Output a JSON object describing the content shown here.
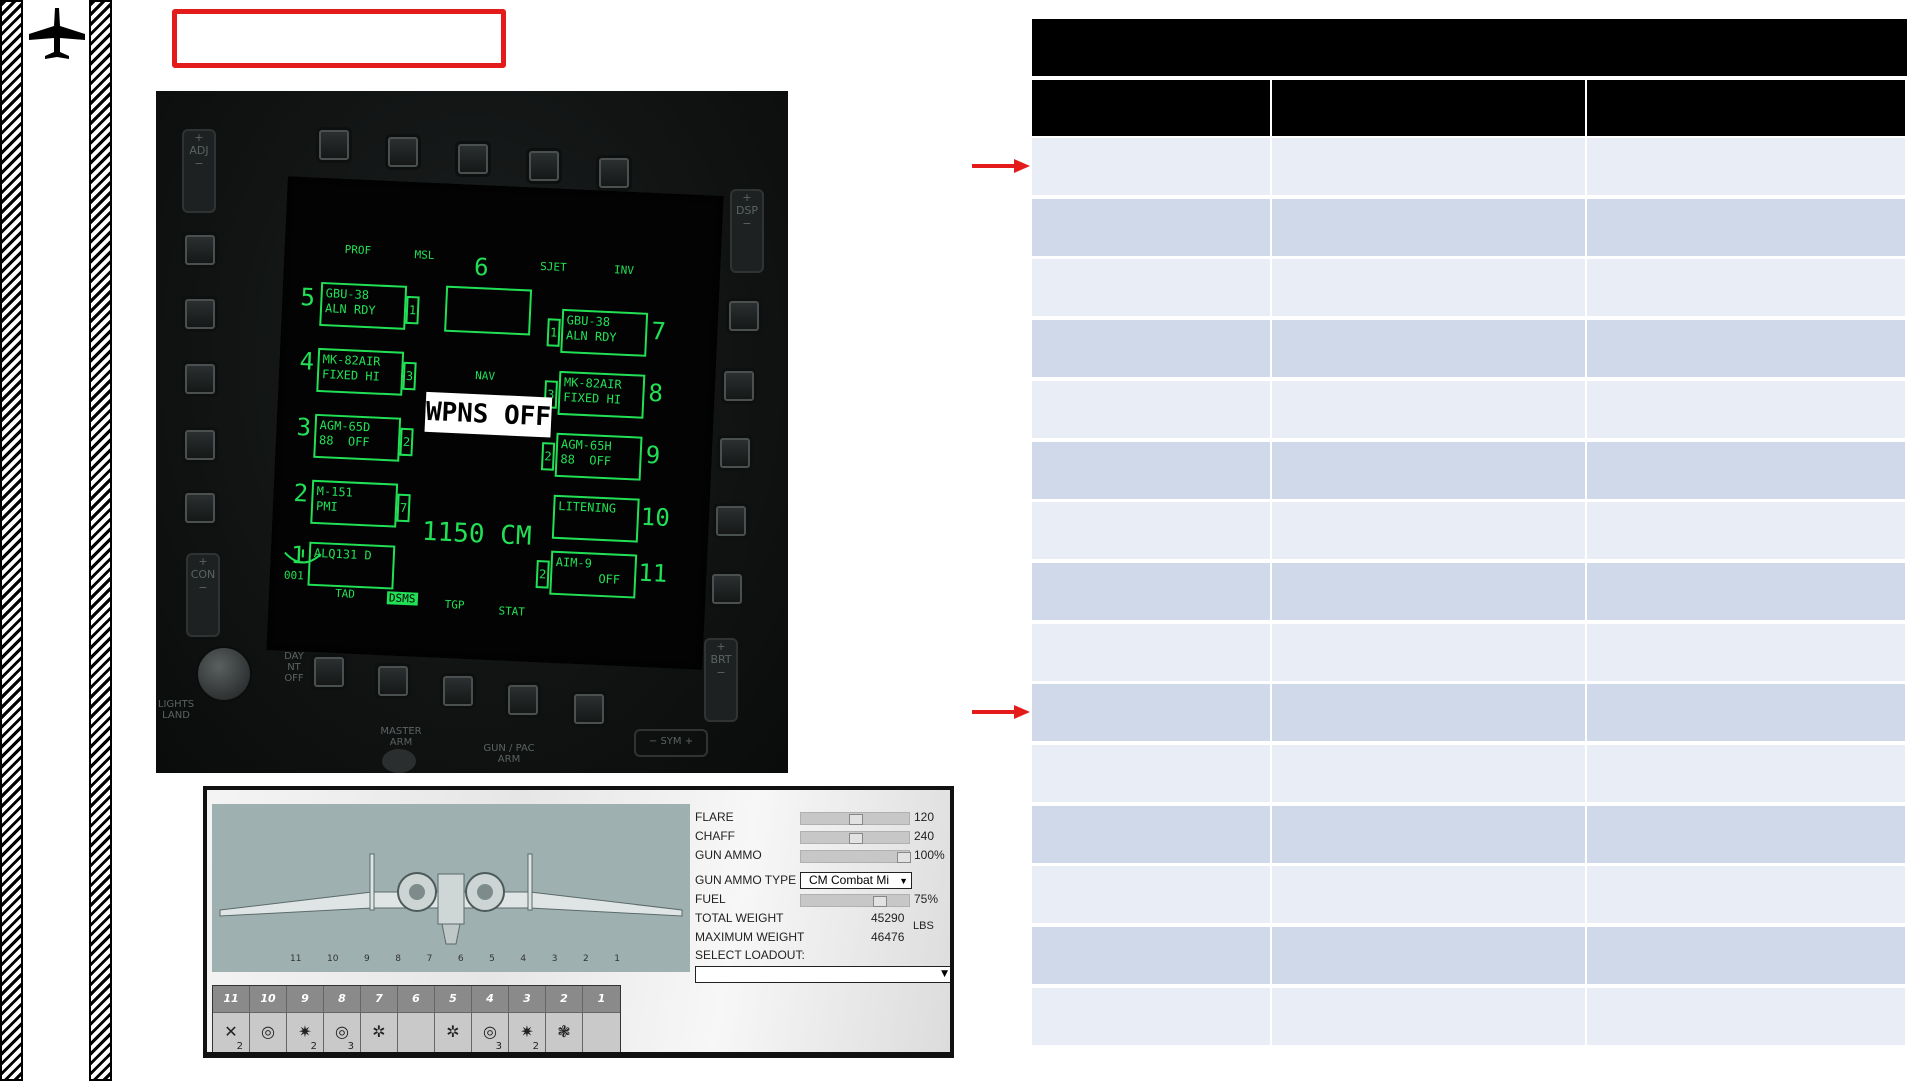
{
  "mfcd": {
    "top_labels": [
      "PROF",
      "MSL",
      "SJET",
      "INV"
    ],
    "station_center": "6",
    "left_stations": [
      {
        "num": "5",
        "line1": "GBU-38",
        "line2": "ALN RDY",
        "qty": "1",
        "off": ""
      },
      {
        "num": "4",
        "line1": "MK-82AIR",
        "line2": "FIXED HI",
        "qty": "3",
        "off": ""
      },
      {
        "num": "3",
        "line1": "AGM-65D",
        "line2": "88",
        "qty": "2",
        "off": "OFF"
      },
      {
        "num": "2",
        "line1": "M-151",
        "line2": "PMI",
        "qty": "7",
        "off": ""
      },
      {
        "num": "1",
        "line1": "ALQ131 D",
        "line2": "",
        "qty": "",
        "off": ""
      }
    ],
    "right_stations": [
      {
        "num": "7",
        "line1": "GBU-38",
        "line2": "ALN RDY",
        "qty": "1",
        "off": ""
      },
      {
        "num": "8",
        "line1": "MK-82AIR",
        "line2": "FIXED HI",
        "qty": "3",
        "off": ""
      },
      {
        "num": "9",
        "line1": "AGM-65H",
        "line2": "88",
        "qty": "2",
        "off": "OFF"
      },
      {
        "num": "10",
        "line1": "LITENING",
        "line2": "",
        "qty": "",
        "off": ""
      },
      {
        "num": "11",
        "line1": "AIM-9",
        "line2": "",
        "qty": "2",
        "off": "OFF"
      }
    ],
    "mode": "NAV",
    "status": "WPNS OFF",
    "countermeasures": "1150 CM",
    "steerpoint": "001",
    "bottom_labels": [
      "TAD",
      "DSMS",
      "TGP",
      "STAT"
    ],
    "bezel": {
      "adj": "ADJ",
      "dsp": "DSP",
      "con": "CON",
      "brt": "BRT",
      "sym": "SYM",
      "day_nt_off": "DAY\nNT\nOFF",
      "lights_land": "LIGHTS\nLAND",
      "master_arm": "MASTER\nARM",
      "gun_pac_arm": "GUN / PAC\nARM"
    }
  },
  "loadout": {
    "plane_station_numbers": [
      "11",
      "10",
      "9",
      "8",
      "7",
      "6",
      "5",
      "4",
      "3",
      "2",
      "1"
    ],
    "stations": [
      {
        "num": "11",
        "icon": "✕",
        "count": "2"
      },
      {
        "num": "10",
        "icon": "◎",
        "count": ""
      },
      {
        "num": "9",
        "icon": "✷",
        "count": "2"
      },
      {
        "num": "8",
        "icon": "◎",
        "count": "3"
      },
      {
        "num": "7",
        "icon": "✲",
        "count": ""
      },
      {
        "num": "6",
        "icon": "",
        "count": ""
      },
      {
        "num": "5",
        "icon": "✲",
        "count": ""
      },
      {
        "num": "4",
        "icon": "◎",
        "count": "3"
      },
      {
        "num": "3",
        "icon": "✷",
        "count": "2"
      },
      {
        "num": "2",
        "icon": "❃",
        "count": ""
      },
      {
        "num": "1",
        "icon": "",
        "count": ""
      }
    ],
    "flare_label": "FLARE",
    "flare_value": "120",
    "flare_level": 0.5,
    "chaff_label": "CHAFF",
    "chaff_value": "240",
    "chaff_level": 0.5,
    "gun_ammo_label": "GUN AMMO",
    "gun_ammo_value": "100%",
    "gun_ammo_level": 1.0,
    "gun_ammo_type_label": "GUN AMMO TYPE",
    "gun_ammo_type_value": "CM Combat Mi",
    "fuel_label": "FUEL",
    "fuel_value": "75%",
    "fuel_level": 0.75,
    "total_weight_label": "TOTAL WEIGHT",
    "total_weight_value": "45290",
    "max_weight_label": "MAXIMUM WEIGHT",
    "max_weight_value": "46476",
    "weight_unit": "LBS",
    "select_loadout_label": "SELECT LOADOUT:"
  },
  "table": {
    "row_count": 15,
    "arrow_rows": [
      0,
      9
    ],
    "colors": {
      "header": "#000000",
      "row_light": "#e8edf6",
      "row_dark": "#cfd9ea",
      "arrow": "#e31b1b"
    }
  }
}
